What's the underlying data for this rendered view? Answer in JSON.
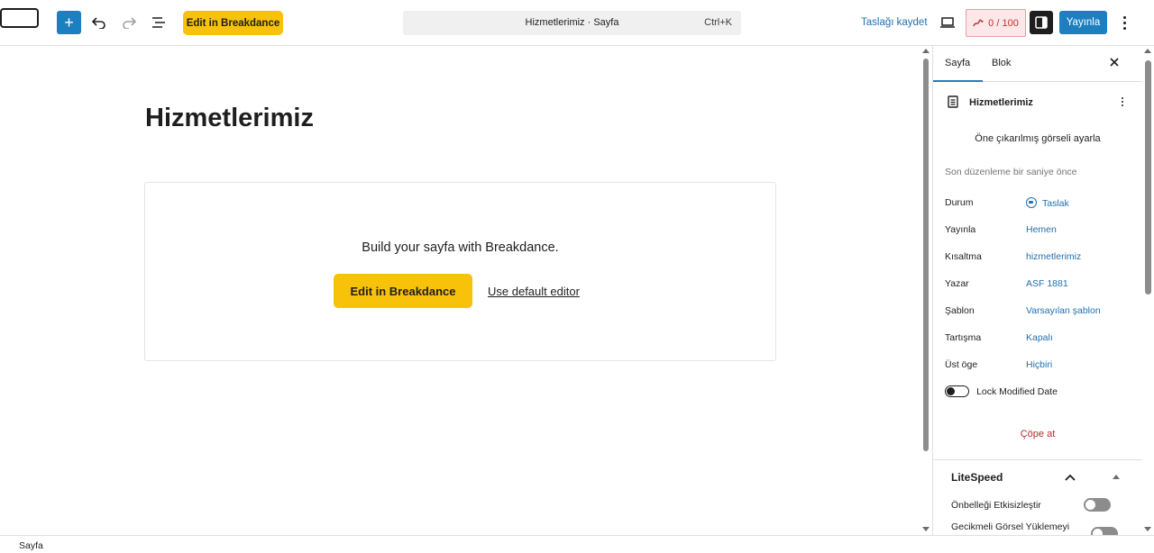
{
  "header": {
    "add_icon_glyph": "+",
    "edit_breakdance_label": "Edit in Breakdance",
    "command_title": "Hizmetlerimiz · Sayfa",
    "command_shortcut": "Ctrl+K",
    "save_draft_label": "Taslağı kaydet",
    "seo_score": "0 / 100",
    "publish_label": "Yayınla"
  },
  "editor": {
    "page_title": "Hizmetlerimiz",
    "breakdance_prompt": "Build your sayfa with Breakdance.",
    "edit_breakdance_label": "Edit in Breakdance",
    "default_editor_label": "Use default editor"
  },
  "sidebar": {
    "tabs": [
      {
        "label": "Sayfa",
        "active": true
      },
      {
        "label": "Blok",
        "active": false
      }
    ],
    "doc_title": "Hizmetlerimiz",
    "featured_image_label": "Öne çıkarılmış görseli ayarla",
    "last_edited": "Son düzenleme bir saniye önce",
    "properties": [
      {
        "key": "Durum",
        "value": "Taslak"
      },
      {
        "key": "Yayınla",
        "value": "Hemen"
      },
      {
        "key": "Kısaltma",
        "value": "hizmetlerimiz"
      },
      {
        "key": "Yazar",
        "value": "ASF 1881"
      },
      {
        "key": "Şablon",
        "value": "Varsayılan şablon"
      },
      {
        "key": "Tartışma",
        "value": "Kapalı"
      },
      {
        "key": "Üst öge",
        "value": "Hiçbiri"
      }
    ],
    "lock_modified_label": "Lock Modified Date",
    "trash_label": "Çöpe at",
    "litespeed": {
      "title": "LiteSpeed",
      "options": [
        "Önbelleği Etkisizleştir",
        "Gecikmeli Görsel Yüklemeyi"
      ]
    }
  },
  "footer": {
    "breadcrumb": "Sayfa"
  },
  "colors": {
    "accent": "#1e7fc0",
    "breakdance_yellow": "#f9c20a",
    "link": "#2271b1",
    "danger": "#b32d2e"
  }
}
